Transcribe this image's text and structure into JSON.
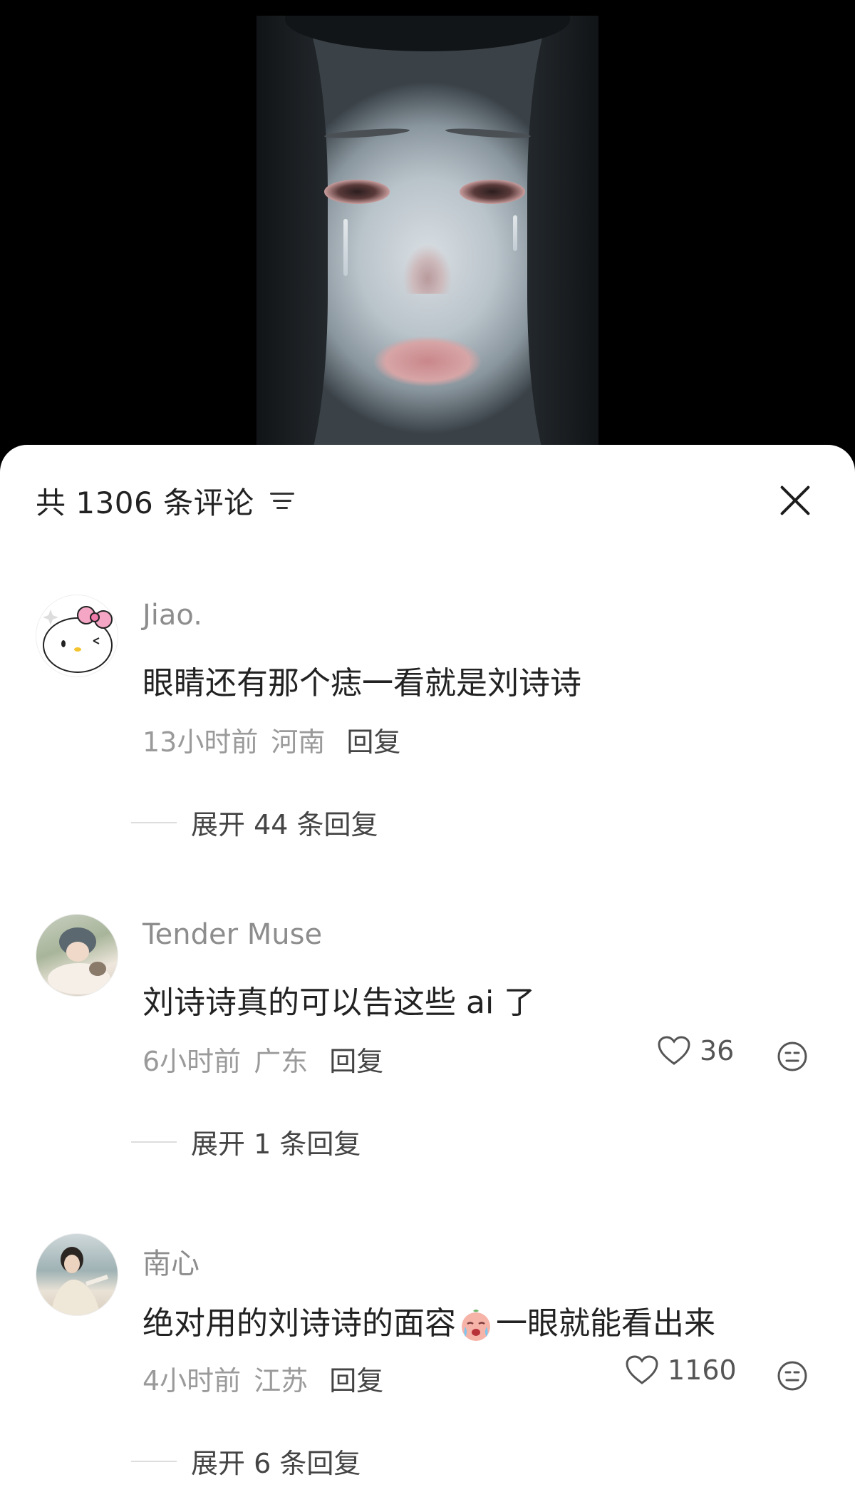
{
  "header": {
    "title": "共 1306 条评论"
  },
  "comments": [
    {
      "username": "Jiao.",
      "text": "眼睛还有那个痣一看就是刘诗诗",
      "time": "13小时前",
      "location": "河南",
      "reply_label": "回复",
      "likes": "",
      "expand_label": "展开 44 条回复"
    },
    {
      "username": "Tender Muse",
      "text": "刘诗诗真的可以告这些 ai 了",
      "time": "6小时前",
      "location": "广东",
      "reply_label": "回复",
      "likes": "36",
      "expand_label": "展开 1 条回复"
    },
    {
      "username": "南心",
      "text_before": "绝对用的刘诗诗的面容",
      "text_after": "一眼就能看出来",
      "time": "4小时前",
      "location": "江苏",
      "reply_label": "回复",
      "likes": "1160",
      "expand_label": "展开 6 条回复"
    }
  ],
  "icons": {
    "filter": "filter-icon",
    "close": "close-icon",
    "like": "heart-icon",
    "dislike": "meh-face-icon",
    "inline_emoji": "crying-emoji-icon"
  },
  "colors": {
    "sheet_bg": "#ffffff",
    "username": "#8d8d8d",
    "meta": "#9a9a9a",
    "text": "#222222"
  }
}
